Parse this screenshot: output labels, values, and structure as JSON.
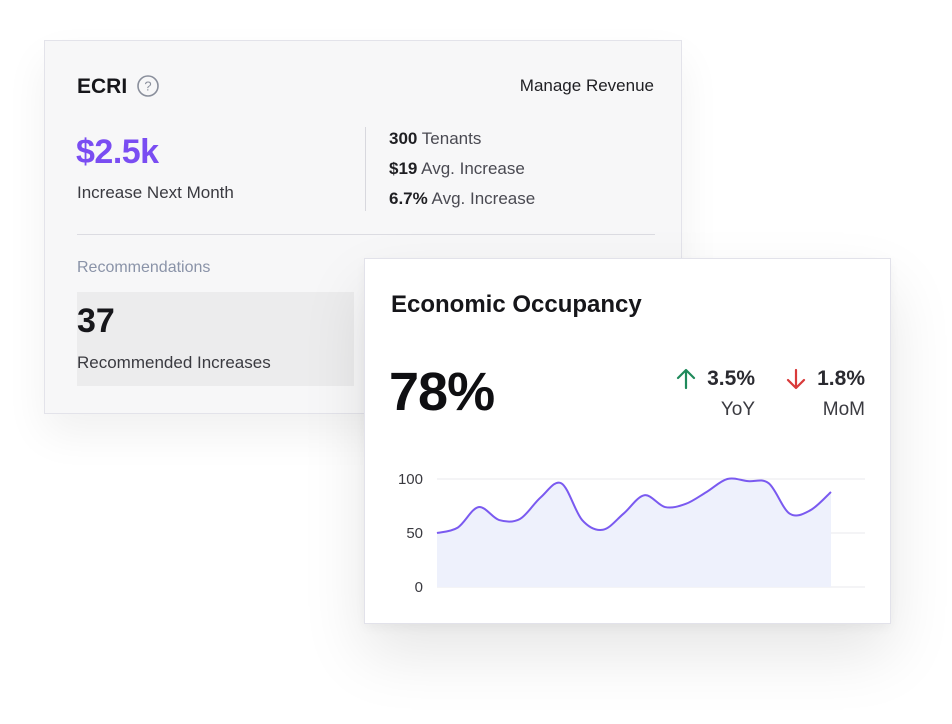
{
  "ecri": {
    "title": "ECRI",
    "help_icon": "question-circle-icon",
    "manage_link": "Manage Revenue",
    "amount": "$2.5k",
    "amount_caption": "Increase Next Month",
    "stats": [
      {
        "value": "300",
        "label": "Tenants"
      },
      {
        "value": "$19",
        "label": "Avg. Increase"
      },
      {
        "value": "6.7%",
        "label": "Avg. Increase"
      }
    ],
    "recommendations_label": "Recommendations",
    "recommended_count": "37",
    "recommended_caption": "Recommended Increases",
    "accent_color": "#7a4df2"
  },
  "occupancy": {
    "title": "Economic Occupancy",
    "value": "78%",
    "yoy": {
      "value": "3.5%",
      "label": "YoY",
      "direction": "up",
      "icon": "arrow-up-icon",
      "color": "#1f8a5b"
    },
    "mom": {
      "value": "1.8%",
      "label": "MoM",
      "direction": "down",
      "icon": "arrow-down-icon",
      "color": "#d93a3a"
    }
  },
  "chart_data": {
    "type": "area",
    "title": "",
    "xlabel": "",
    "ylabel": "",
    "ylim": [
      0,
      100
    ],
    "yticks": [
      100,
      50,
      0
    ],
    "x": [
      0,
      1,
      2,
      3,
      4,
      5,
      6,
      7,
      8,
      9,
      10,
      11,
      12,
      13,
      14,
      15,
      16,
      17,
      18,
      19,
      20,
      21,
      22
    ],
    "series": [
      {
        "values": [
          50,
          55,
          74,
          62,
          63,
          83,
          96,
          62,
          53,
          68,
          85,
          74,
          77,
          88,
          100,
          98,
          96,
          68,
          71,
          88
        ]
      }
    ],
    "line_color": "#7a5af0",
    "fill_color": "#eef1fc",
    "grid": true
  }
}
